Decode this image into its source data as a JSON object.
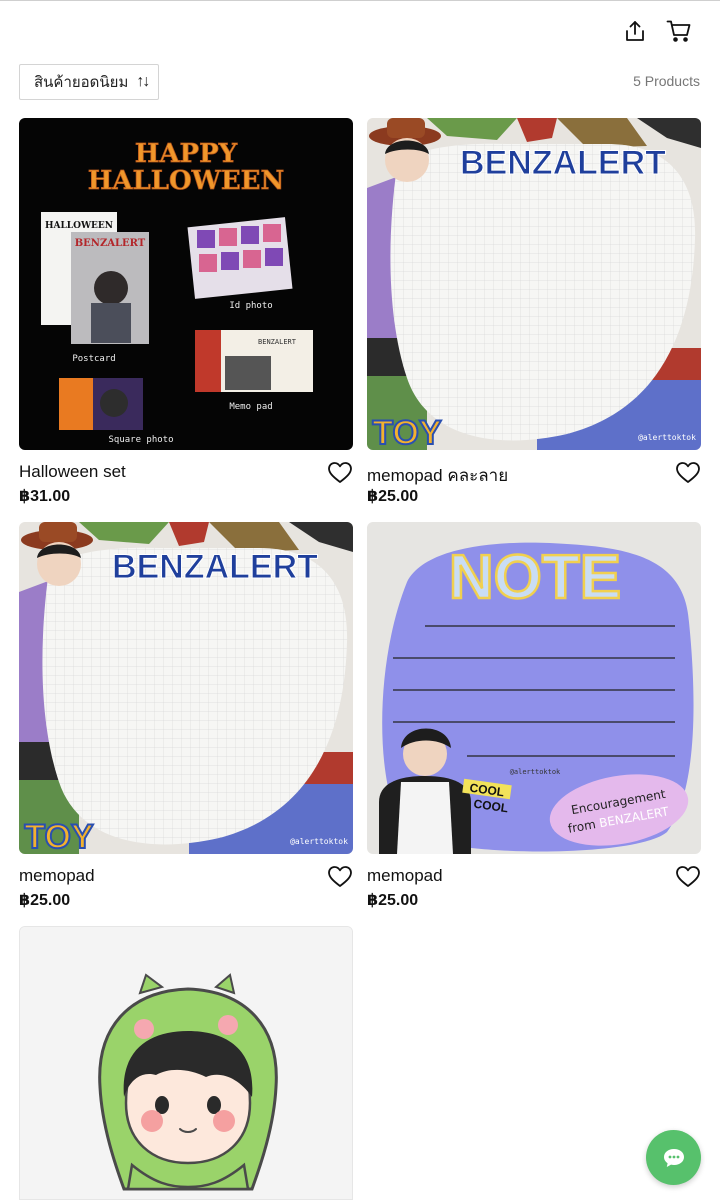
{
  "toolbar": {
    "sort_label": "สินค้ายอดนิยม",
    "product_count": "5 Products"
  },
  "products": [
    {
      "title": "Halloween set",
      "price": "฿31.00"
    },
    {
      "title": "memopad คละลาย",
      "price": "฿25.00"
    },
    {
      "title": "memopad",
      "price": "฿25.00"
    },
    {
      "title": "memopad",
      "price": "฿25.00"
    },
    {
      "title": "",
      "price": ""
    }
  ],
  "artwork": {
    "halloween": {
      "headline_1": "HAPPY",
      "headline_2": "HALLOWEEN",
      "card_title": "HALLOWEEN",
      "card_brand": "BENZALERT",
      "label_postcard": "Postcard",
      "label_id_photo": "Id photo",
      "label_memo_pad": "Memo pad",
      "label_square_photo": "Square photo"
    },
    "toy_memo": {
      "brand": "BENZALERT",
      "toy_text": "TOY",
      "handle": "@alerttoktok"
    },
    "note_memo": {
      "title": "NOTE",
      "handle": "@alerttoktok",
      "cool": "COOL",
      "encouragement_1": "Encouragement",
      "encouragement_2": "from",
      "encouragement_brand": "BENZALERT"
    }
  },
  "icons": {
    "share": "share-icon",
    "cart": "cart-icon",
    "sort": "sort-icon",
    "favorite": "heart-icon",
    "chat": "chat-icon"
  },
  "colors": {
    "chat_button": "#57c16c",
    "count_text": "#777777",
    "halloween_orange": "#f0972b",
    "brand_blue": "#1f3f9c",
    "note_purple": "#8f90ea"
  }
}
